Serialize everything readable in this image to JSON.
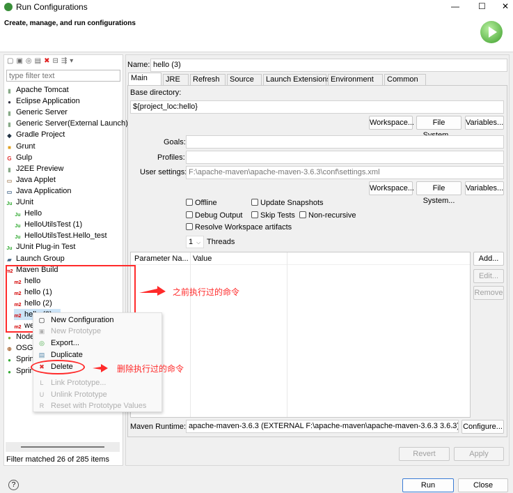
{
  "window": {
    "title": "Run Configurations",
    "subtitle": "Create, manage, and run configurations",
    "controls": {
      "minimize": "—",
      "maximize": "☐",
      "close": "✕"
    }
  },
  "left": {
    "filter_placeholder": "type filter text",
    "items": [
      {
        "label": "Apache Tomcat",
        "icon": "server-icon",
        "level": 0
      },
      {
        "label": "Eclipse Application",
        "icon": "eclipse-icon",
        "level": 0
      },
      {
        "label": "Generic Server",
        "icon": "server-icon",
        "level": 0
      },
      {
        "label": "Generic Server(External Launch)",
        "icon": "server-icon",
        "level": 0
      },
      {
        "label": "Gradle Project",
        "icon": "gradle-icon",
        "level": 0
      },
      {
        "label": "Grunt",
        "icon": "grunt-icon",
        "level": 0
      },
      {
        "label": "Gulp",
        "icon": "gulp-icon",
        "level": 0
      },
      {
        "label": "J2EE Preview",
        "icon": "server-icon",
        "level": 0
      },
      {
        "label": "Java Applet",
        "icon": "applet-icon",
        "level": 0
      },
      {
        "label": "Java Application",
        "icon": "java-app-icon",
        "level": 0
      },
      {
        "label": "JUnit",
        "icon": "junit-icon",
        "level": 0
      },
      {
        "label": "Hello",
        "icon": "junit-icon",
        "level": 1
      },
      {
        "label": "HelloUtilsTest (1)",
        "icon": "junit-icon",
        "level": 1
      },
      {
        "label": "HelloUtilsTest.Hello_test",
        "icon": "junit-icon",
        "level": 1
      },
      {
        "label": "JUnit Plug-in Test",
        "icon": "junit-plugin-icon",
        "level": 0
      },
      {
        "label": "Launch Group",
        "icon": "launch-group-icon",
        "level": 0
      },
      {
        "label": "Maven Build",
        "icon": "maven-icon",
        "level": 0
      },
      {
        "label": "hello",
        "icon": "maven-icon",
        "level": 1
      },
      {
        "label": "hello (1)",
        "icon": "maven-icon",
        "level": 1
      },
      {
        "label": "hello (2)",
        "icon": "maven-icon",
        "level": 1
      },
      {
        "label": "hello (3)",
        "icon": "maven-icon",
        "level": 1,
        "selected": true
      },
      {
        "label": "we",
        "icon": "maven-icon",
        "level": 1
      },
      {
        "label": "Node",
        "icon": "node-icon",
        "level": 0
      },
      {
        "label": "OSGi",
        "icon": "osgi-icon",
        "level": 0
      },
      {
        "label": "Sprin",
        "icon": "spring-icon",
        "level": 0
      },
      {
        "label": "Sprin",
        "icon": "spring-icon",
        "level": 0
      }
    ],
    "status": "Filter matched 26 of 285 items"
  },
  "main": {
    "name_label": "Name:",
    "name_value": "hello (3)",
    "tabs": [
      "Main",
      "JRE",
      "Refresh",
      "Source",
      "Launch Extensions",
      "Environment",
      "Common"
    ],
    "base_dir_label": "Base directory:",
    "base_dir_value": "${project_loc:hello}",
    "workspace": "Workspace...",
    "filesystem": "File System...",
    "variables": "Variables...",
    "goals_label": "Goals:",
    "profiles_label": "Profiles:",
    "user_settings_label": "User settings:",
    "user_settings_value": "F:\\apache-maven\\apache-maven-3.6.3\\conf\\settings.xml",
    "checkboxes": {
      "offline": "Offline",
      "update": "Update Snapshots",
      "debug": "Debug Output",
      "skip": "Skip Tests",
      "nonrec": "Non-recursive",
      "resolve": "Resolve Workspace artifacts"
    },
    "threads_value": "1",
    "threads_label": "Threads",
    "table_headers": [
      "Parameter Na...",
      "Value"
    ],
    "add": "Add...",
    "edit": "Edit...",
    "remove": "Remove",
    "runtime_label": "Maven Runtime:",
    "runtime_value": "apache-maven-3.6.3 (EXTERNAL F:\\apache-maven\\apache-maven-3.6.3 3.6.3)",
    "configure": "Configure...",
    "revert": "Revert",
    "apply": "Apply"
  },
  "footer": {
    "help": "?",
    "run": "Run",
    "close": "Close"
  },
  "context_menu": {
    "new_config": "New Configuration",
    "new_proto": "New Prototype",
    "export": "Export...",
    "duplicate": "Duplicate",
    "delete": "Delete",
    "link": "Link Prototype...",
    "unlink": "Unlink Prototype",
    "reset": "Reset with Prototype Values"
  },
  "annotations": {
    "top": "之前执行过的命令",
    "bottom": "删除执行过的命令",
    "color": "#ff2a2a"
  }
}
